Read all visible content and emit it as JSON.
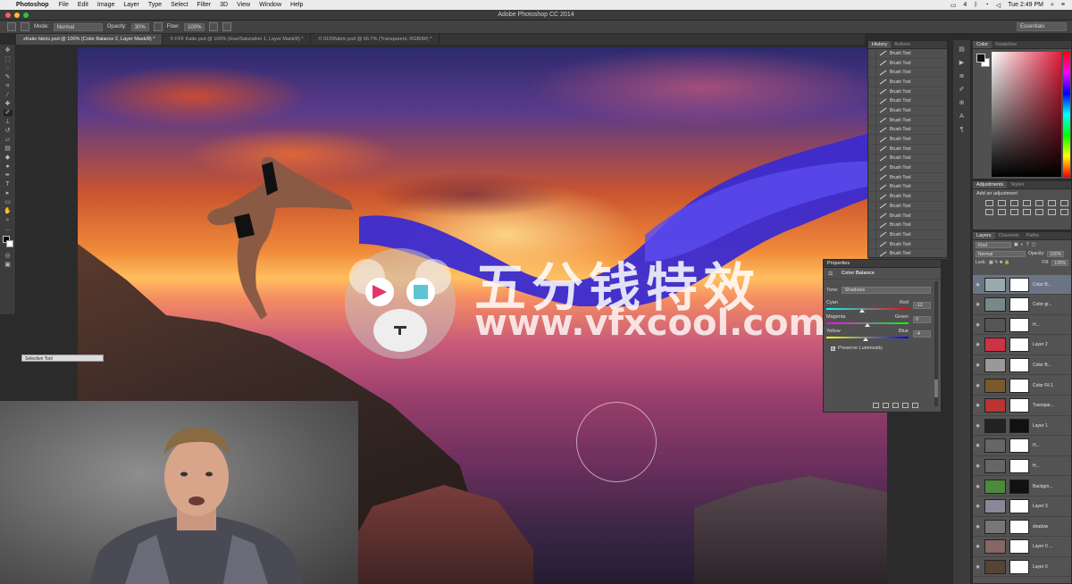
{
  "menubar": {
    "app": "Photoshop",
    "items": [
      "File",
      "Edit",
      "Image",
      "Layer",
      "Type",
      "Select",
      "Filter",
      "3D",
      "View",
      "Window",
      "Help"
    ],
    "clock": "Tue 2:49 PM",
    "battery": "4"
  },
  "window": {
    "title": "Adobe Photoshop CC 2014"
  },
  "options": {
    "mode_label": "Mode:",
    "mode_value": "Normal",
    "opacity_label": "Opacity:",
    "opacity_value": "30%",
    "flow_label": "Flow:",
    "flow_value": "100%",
    "workspace": "Essentials"
  },
  "tabs": [
    {
      "label": "zKatie fabric.psd @ 100% (Color Balance 2, Layer Mask/8) *",
      "active": true
    },
    {
      "label": "© FFF Katie.psd @ 100% (Hue/Saturation 1, Layer Mask/8) *",
      "active": false
    },
    {
      "label": "© 0105fabric.psd @ 66.7% (Transparent, RGB/8#) *",
      "active": false
    }
  ],
  "canvas": {
    "watermark_cn": "五分钱特效",
    "watermark_url": "www.vfxcool.com",
    "colors": {
      "fabric": "#3b2bd0",
      "fabric_light": "#5b4cf0"
    }
  },
  "tool_preset": "Selective Tool",
  "history": {
    "tabs": [
      "History",
      "Actions"
    ],
    "items": [
      "Brush Tool",
      "Brush Tool",
      "Brush Tool",
      "Brush Tool",
      "Brush Tool",
      "Brush Tool",
      "Brush Tool",
      "Brush Tool",
      "Brush Tool",
      "Brush Tool",
      "Brush Tool",
      "Brush Tool",
      "Brush Tool",
      "Brush Tool",
      "Brush Tool",
      "Brush Tool",
      "Brush Tool",
      "Brush Tool",
      "Brush Tool",
      "Brush Tool",
      "Brush Tool",
      "Brush Tool"
    ]
  },
  "color_panel": {
    "tabs": [
      "Color",
      "Swatches"
    ],
    "fg": "#111111",
    "bg": "#ffffff"
  },
  "adjustments": {
    "tabs": [
      "Adjustments",
      "Styles"
    ],
    "label": "Add an adjustment"
  },
  "layers": {
    "tabs": [
      "Layers",
      "Channels",
      "Paths"
    ],
    "filter": "Kind",
    "blend": "Normal",
    "opacity_label": "Opacity:",
    "opacity_value": "100%",
    "lock_label": "Lock:",
    "fill_label": "Fill:",
    "fill_value": "100%",
    "rows": [
      {
        "name": "Color B...",
        "selected": true
      },
      {
        "name": "Color gr...",
        "selected": false
      },
      {
        "name": "H...",
        "selected": false
      },
      {
        "name": "Layer 2",
        "selected": false
      },
      {
        "name": "Color B...",
        "selected": false
      },
      {
        "name": "Color Fil 1",
        "selected": false
      },
      {
        "name": "Transpar...",
        "selected": false
      },
      {
        "name": "Layer 1",
        "selected": false
      },
      {
        "name": "H...",
        "selected": false
      },
      {
        "name": "H...",
        "selected": false
      },
      {
        "name": "Backgro...",
        "selected": false
      },
      {
        "name": "Layer 3",
        "selected": false
      },
      {
        "name": "shadow",
        "selected": false
      },
      {
        "name": "Layer 0 ...",
        "selected": false
      },
      {
        "name": "Layer 0",
        "selected": false
      }
    ]
  },
  "properties": {
    "title": "Properties",
    "type": "Color Balance",
    "tone_label": "Tone:",
    "tone_value": "Shadows",
    "sliders": [
      {
        "left": "Cyan",
        "right": "Red",
        "value": "-12",
        "pos": 0.44,
        "track": "cyan-red"
      },
      {
        "left": "Magenta",
        "right": "Green",
        "value": "0",
        "pos": 0.5,
        "track": "magenta-green"
      },
      {
        "left": "Yellow",
        "right": "Blue",
        "value": "-4",
        "pos": 0.48,
        "track": "yellow-blue"
      }
    ],
    "preserve_label": "Preserve Luminosity",
    "preserve_checked": true
  }
}
